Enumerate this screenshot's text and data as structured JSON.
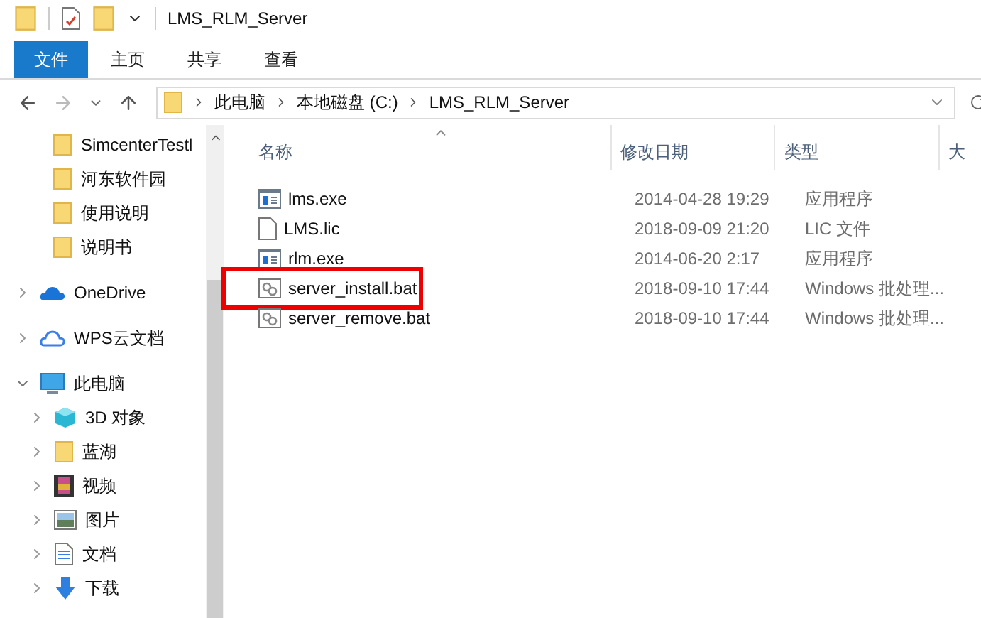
{
  "window": {
    "title": "LMS_RLM_Server"
  },
  "ribbon_tabs": [
    {
      "label": "文件",
      "kind": "file"
    },
    {
      "label": "主页",
      "kind": "tab"
    },
    {
      "label": "共享",
      "kind": "tab"
    },
    {
      "label": "查看",
      "kind": "tab"
    }
  ],
  "address": {
    "segments": [
      "此电脑",
      "本地磁盘 (C:)",
      "LMS_RLM_Server"
    ]
  },
  "quick_access": [
    {
      "label": "SimcenterTestl",
      "kind": "folder"
    },
    {
      "label": "河东软件园",
      "kind": "folder"
    },
    {
      "label": "使用说明",
      "kind": "folder"
    },
    {
      "label": "说明书",
      "kind": "folder"
    }
  ],
  "tree": [
    {
      "label": "OneDrive",
      "kind": "onedrive",
      "expanded": false
    },
    {
      "label": "WPS云文档",
      "kind": "cloud",
      "expanded": false
    },
    {
      "label": "此电脑",
      "kind": "pc",
      "expanded": true,
      "children": [
        {
          "label": "3D 对象",
          "kind": "cube",
          "expanded": false
        },
        {
          "label": "蓝湖",
          "kind": "folder",
          "expanded": false
        },
        {
          "label": "视频",
          "kind": "video",
          "expanded": false
        },
        {
          "label": "图片",
          "kind": "pictures",
          "expanded": false
        },
        {
          "label": "文档",
          "kind": "document",
          "expanded": false
        },
        {
          "label": "下载",
          "kind": "download",
          "expanded": false
        }
      ]
    }
  ],
  "columns": [
    {
      "label": "名称",
      "sorted": true
    },
    {
      "label": "修改日期",
      "sorted": false
    },
    {
      "label": "类型",
      "sorted": false
    },
    {
      "label": "大",
      "sorted": false
    }
  ],
  "files": [
    {
      "name": "lms.exe",
      "date": "2014-04-28 19:29",
      "type": "应用程序",
      "kind": "exe",
      "highlighted": false
    },
    {
      "name": "LMS.lic",
      "date": "2018-09-09 21:20",
      "type": "LIC 文件",
      "kind": "file",
      "highlighted": false
    },
    {
      "name": "rlm.exe",
      "date": "2014-06-20 2:17",
      "type": "应用程序",
      "kind": "exe",
      "highlighted": false
    },
    {
      "name": "server_install.bat",
      "date": "2018-09-10 17:44",
      "type": "Windows 批处理...",
      "kind": "bat",
      "highlighted": true
    },
    {
      "name": "server_remove.bat",
      "date": "2018-09-10 17:44",
      "type": "Windows 批处理...",
      "kind": "bat",
      "highlighted": false
    }
  ]
}
